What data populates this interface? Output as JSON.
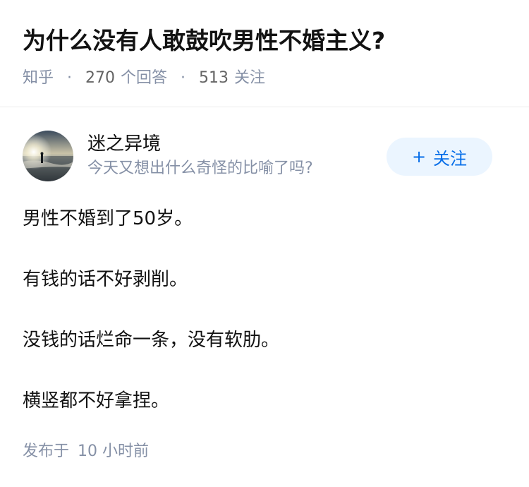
{
  "question": {
    "title": "为什么没有人敢鼓吹男性不婚主义?",
    "source": "知乎",
    "answers_count": "270",
    "answers_label": "个回答",
    "followers_count": "513",
    "followers_label": "关注"
  },
  "author": {
    "name": "迷之异境",
    "bio": "今天又想出什么奇怪的比喻了吗?",
    "avatar_icon": "beach-sunset-avatar",
    "follow_label": "关注",
    "follow_icon": "plus-icon"
  },
  "answer": {
    "paragraphs": [
      "男性不婚到了50岁。",
      "有钱的话不好剥削。",
      "没钱的话烂命一条，没有软肋。",
      "横竖都不好拿捏。"
    ],
    "published_label": "发布于",
    "published_time": "10 小时前"
  },
  "colors": {
    "text_primary": "#121212",
    "text_secondary": "#8590a6",
    "accent": "#056de8",
    "follow_bg": "#ebf5ff",
    "divider": "#ebebeb"
  }
}
